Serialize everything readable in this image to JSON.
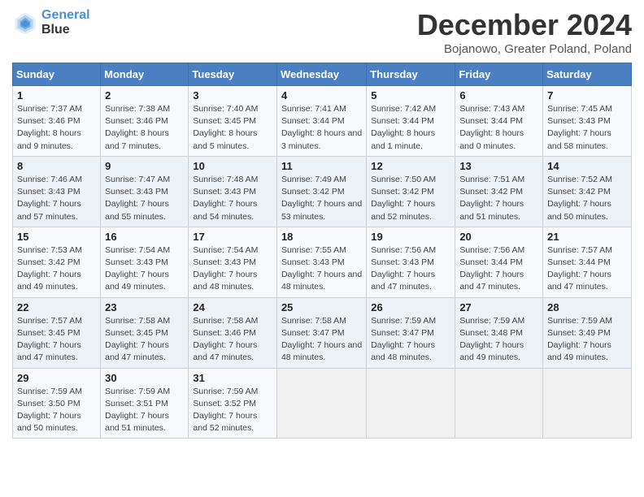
{
  "header": {
    "logo_line1": "General",
    "logo_line2": "Blue",
    "title": "December 2024",
    "subtitle": "Bojanowo, Greater Poland, Poland"
  },
  "calendar": {
    "days_of_week": [
      "Sunday",
      "Monday",
      "Tuesday",
      "Wednesday",
      "Thursday",
      "Friday",
      "Saturday"
    ],
    "weeks": [
      [
        null,
        {
          "day": "2",
          "sunrise": "Sunrise: 7:38 AM",
          "sunset": "Sunset: 3:46 PM",
          "daylight": "Daylight: 8 hours and 7 minutes."
        },
        {
          "day": "3",
          "sunrise": "Sunrise: 7:40 AM",
          "sunset": "Sunset: 3:45 PM",
          "daylight": "Daylight: 8 hours and 5 minutes."
        },
        {
          "day": "4",
          "sunrise": "Sunrise: 7:41 AM",
          "sunset": "Sunset: 3:44 PM",
          "daylight": "Daylight: 8 hours and 3 minutes."
        },
        {
          "day": "5",
          "sunrise": "Sunrise: 7:42 AM",
          "sunset": "Sunset: 3:44 PM",
          "daylight": "Daylight: 8 hours and 1 minute."
        },
        {
          "day": "6",
          "sunrise": "Sunrise: 7:43 AM",
          "sunset": "Sunset: 3:44 PM",
          "daylight": "Daylight: 8 hours and 0 minutes."
        },
        {
          "day": "7",
          "sunrise": "Sunrise: 7:45 AM",
          "sunset": "Sunset: 3:43 PM",
          "daylight": "Daylight: 7 hours and 58 minutes."
        }
      ],
      [
        {
          "day": "1",
          "sunrise": "Sunrise: 7:37 AM",
          "sunset": "Sunset: 3:46 PM",
          "daylight": "Daylight: 8 hours and 9 minutes."
        },
        {
          "day": "9",
          "sunrise": "Sunrise: 7:47 AM",
          "sunset": "Sunset: 3:43 PM",
          "daylight": "Daylight: 7 hours and 55 minutes."
        },
        {
          "day": "10",
          "sunrise": "Sunrise: 7:48 AM",
          "sunset": "Sunset: 3:43 PM",
          "daylight": "Daylight: 7 hours and 54 minutes."
        },
        {
          "day": "11",
          "sunrise": "Sunrise: 7:49 AM",
          "sunset": "Sunset: 3:42 PM",
          "daylight": "Daylight: 7 hours and 53 minutes."
        },
        {
          "day": "12",
          "sunrise": "Sunrise: 7:50 AM",
          "sunset": "Sunset: 3:42 PM",
          "daylight": "Daylight: 7 hours and 52 minutes."
        },
        {
          "day": "13",
          "sunrise": "Sunrise: 7:51 AM",
          "sunset": "Sunset: 3:42 PM",
          "daylight": "Daylight: 7 hours and 51 minutes."
        },
        {
          "day": "14",
          "sunrise": "Sunrise: 7:52 AM",
          "sunset": "Sunset: 3:42 PM",
          "daylight": "Daylight: 7 hours and 50 minutes."
        }
      ],
      [
        {
          "day": "8",
          "sunrise": "Sunrise: 7:46 AM",
          "sunset": "Sunset: 3:43 PM",
          "daylight": "Daylight: 7 hours and 57 minutes."
        },
        {
          "day": "16",
          "sunrise": "Sunrise: 7:54 AM",
          "sunset": "Sunset: 3:43 PM",
          "daylight": "Daylight: 7 hours and 49 minutes."
        },
        {
          "day": "17",
          "sunrise": "Sunrise: 7:54 AM",
          "sunset": "Sunset: 3:43 PM",
          "daylight": "Daylight: 7 hours and 48 minutes."
        },
        {
          "day": "18",
          "sunrise": "Sunrise: 7:55 AM",
          "sunset": "Sunset: 3:43 PM",
          "daylight": "Daylight: 7 hours and 48 minutes."
        },
        {
          "day": "19",
          "sunrise": "Sunrise: 7:56 AM",
          "sunset": "Sunset: 3:43 PM",
          "daylight": "Daylight: 7 hours and 47 minutes."
        },
        {
          "day": "20",
          "sunrise": "Sunrise: 7:56 AM",
          "sunset": "Sunset: 3:44 PM",
          "daylight": "Daylight: 7 hours and 47 minutes."
        },
        {
          "day": "21",
          "sunrise": "Sunrise: 7:57 AM",
          "sunset": "Sunset: 3:44 PM",
          "daylight": "Daylight: 7 hours and 47 minutes."
        }
      ],
      [
        {
          "day": "15",
          "sunrise": "Sunrise: 7:53 AM",
          "sunset": "Sunset: 3:42 PM",
          "daylight": "Daylight: 7 hours and 49 minutes."
        },
        {
          "day": "23",
          "sunrise": "Sunrise: 7:58 AM",
          "sunset": "Sunset: 3:45 PM",
          "daylight": "Daylight: 7 hours and 47 minutes."
        },
        {
          "day": "24",
          "sunrise": "Sunrise: 7:58 AM",
          "sunset": "Sunset: 3:46 PM",
          "daylight": "Daylight: 7 hours and 47 minutes."
        },
        {
          "day": "25",
          "sunrise": "Sunrise: 7:58 AM",
          "sunset": "Sunset: 3:47 PM",
          "daylight": "Daylight: 7 hours and 48 minutes."
        },
        {
          "day": "26",
          "sunrise": "Sunrise: 7:59 AM",
          "sunset": "Sunset: 3:47 PM",
          "daylight": "Daylight: 7 hours and 48 minutes."
        },
        {
          "day": "27",
          "sunrise": "Sunrise: 7:59 AM",
          "sunset": "Sunset: 3:48 PM",
          "daylight": "Daylight: 7 hours and 49 minutes."
        },
        {
          "day": "28",
          "sunrise": "Sunrise: 7:59 AM",
          "sunset": "Sunset: 3:49 PM",
          "daylight": "Daylight: 7 hours and 49 minutes."
        }
      ],
      [
        {
          "day": "22",
          "sunrise": "Sunrise: 7:57 AM",
          "sunset": "Sunset: 3:45 PM",
          "daylight": "Daylight: 7 hours and 47 minutes."
        },
        {
          "day": "30",
          "sunrise": "Sunrise: 7:59 AM",
          "sunset": "Sunset: 3:51 PM",
          "daylight": "Daylight: 7 hours and 51 minutes."
        },
        {
          "day": "31",
          "sunrise": "Sunrise: 7:59 AM",
          "sunset": "Sunset: 3:52 PM",
          "daylight": "Daylight: 7 hours and 52 minutes."
        },
        null,
        null,
        null,
        null
      ],
      [
        {
          "day": "29",
          "sunrise": "Sunrise: 7:59 AM",
          "sunset": "Sunset: 3:50 PM",
          "daylight": "Daylight: 7 hours and 50 minutes."
        },
        null,
        null,
        null,
        null,
        null,
        null
      ]
    ]
  }
}
